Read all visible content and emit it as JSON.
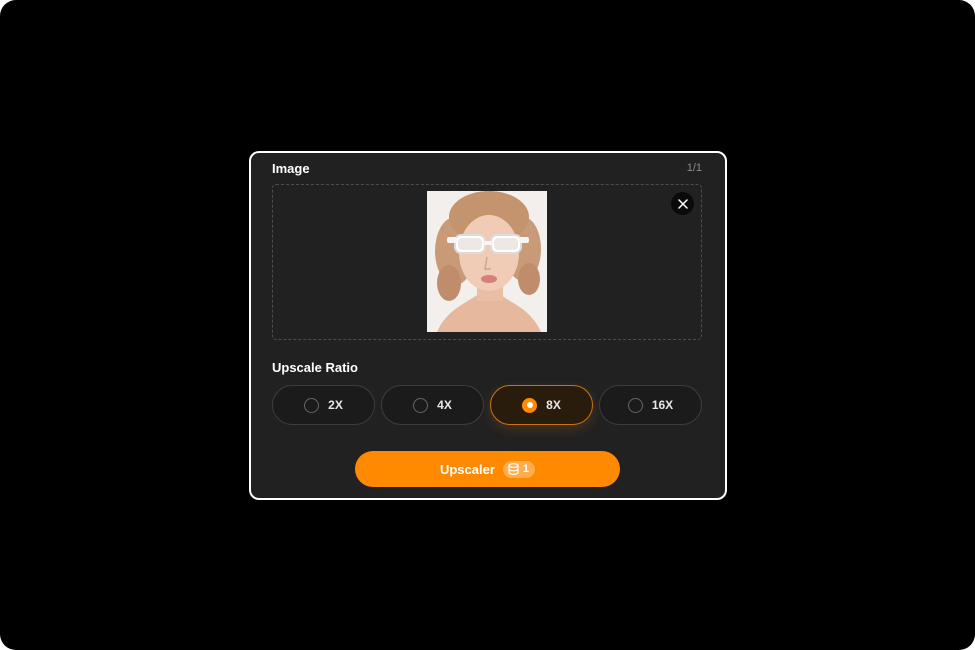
{
  "panel": {
    "image_title": "Image",
    "image_count": "1/1",
    "thumbnail_icon": "portrait-photo",
    "close_icon": "close-icon"
  },
  "upscale": {
    "title": "Upscale Ratio",
    "options": [
      {
        "label": "2X",
        "selected": false
      },
      {
        "label": "4X",
        "selected": false
      },
      {
        "label": "8X",
        "selected": true
      },
      {
        "label": "16X",
        "selected": false
      }
    ]
  },
  "action": {
    "button_label": "Upscaler",
    "credit_icon": "coin-stack-icon",
    "credit_cost": "1"
  },
  "colors": {
    "accent": "#ff8a00",
    "panel_bg": "#212121",
    "screen_bg": "#000000"
  }
}
